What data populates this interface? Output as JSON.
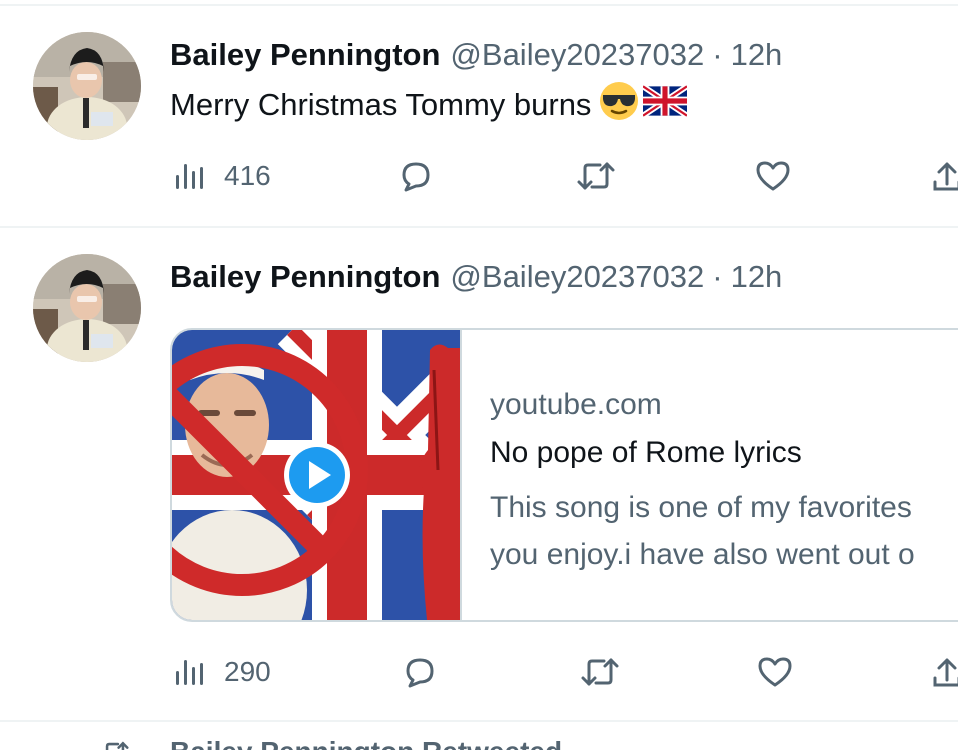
{
  "tweets": [
    {
      "author_name": "Bailey Pennington",
      "author_handle": "@Bailey20237032",
      "time_sep": "·",
      "time": "12h",
      "text": "Merry Christmas Tommy burns",
      "emojis": [
        "😎",
        "🇬🇧"
      ],
      "views": "416"
    },
    {
      "author_name": "Bailey Pennington",
      "author_handle": "@Bailey20237032",
      "time_sep": "·",
      "time": "12h",
      "card": {
        "domain": "youtube.com",
        "title": "No pope of Rome lyrics",
        "description_line1": "This song is one of my favorites",
        "description_line2": "you enjoy.i have also went out o"
      },
      "views": "290"
    }
  ],
  "next_row": {
    "icon": "retweet-icon",
    "text": "Bailey Pennington Retweeted"
  },
  "icons": {
    "views": "bar-chart-icon",
    "reply": "comment-bubble-icon",
    "retweet": "retweet-icon",
    "like": "heart-icon",
    "share": "share-upload-icon",
    "play": "play-icon"
  },
  "colors": {
    "text_primary": "#0f1419",
    "text_secondary": "#536471",
    "divider": "#eff3f4",
    "card_border": "#cfd9de",
    "play_blue": "#1d9bf0"
  }
}
